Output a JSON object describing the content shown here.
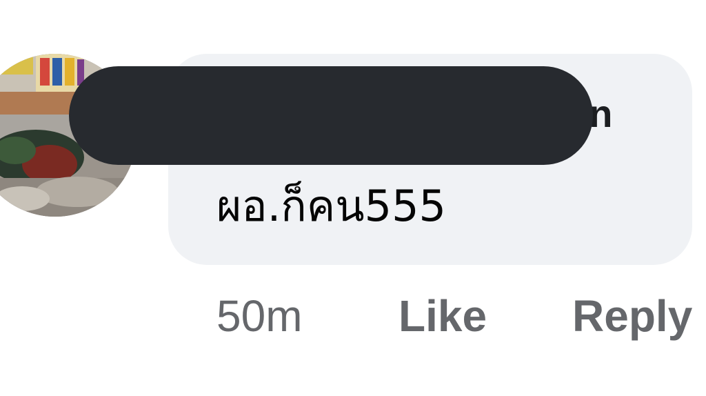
{
  "comment": {
    "author_visible_suffix": "on",
    "text": "ผอ.ก็คน555",
    "timestamp": "50m",
    "like_label": "Like",
    "reply_label": "Reply"
  },
  "colors": {
    "bubble": "#f0f2f5",
    "redaction": "#272a2f",
    "meta_text": "#65676b",
    "body_text": "#050505"
  }
}
